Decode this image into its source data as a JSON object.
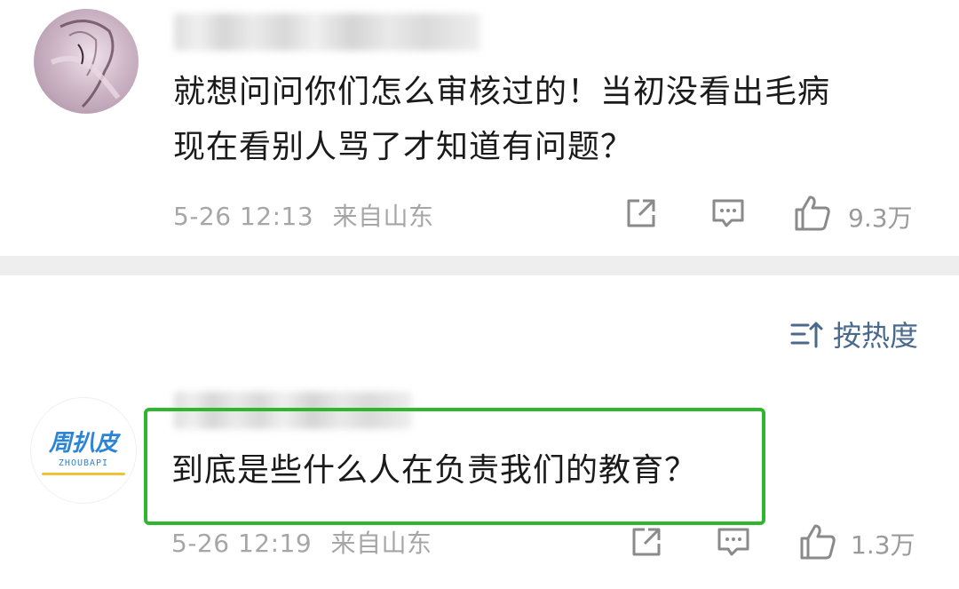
{
  "comments": [
    {
      "text_line1": "就想问问你们怎么审核过的！当初没看出毛病",
      "text_line2": "现在看别人骂了才知道有问题？",
      "time": "5-26 12:13",
      "location": "来自山东",
      "likes": "9.3万"
    },
    {
      "text": "到底是些什么人在负责我们的教育？",
      "time": "5-26 12:19",
      "location": "来自山东",
      "likes": "1.3万",
      "avatar_logo": "周扒皮",
      "avatar_sub": "ZHOUBAPI"
    }
  ],
  "sort": {
    "label": "按热度"
  },
  "colors": {
    "highlight": "#2fb62f",
    "sort_accent": "#4a6a8c",
    "meta_gray": "#a6a6a6"
  }
}
